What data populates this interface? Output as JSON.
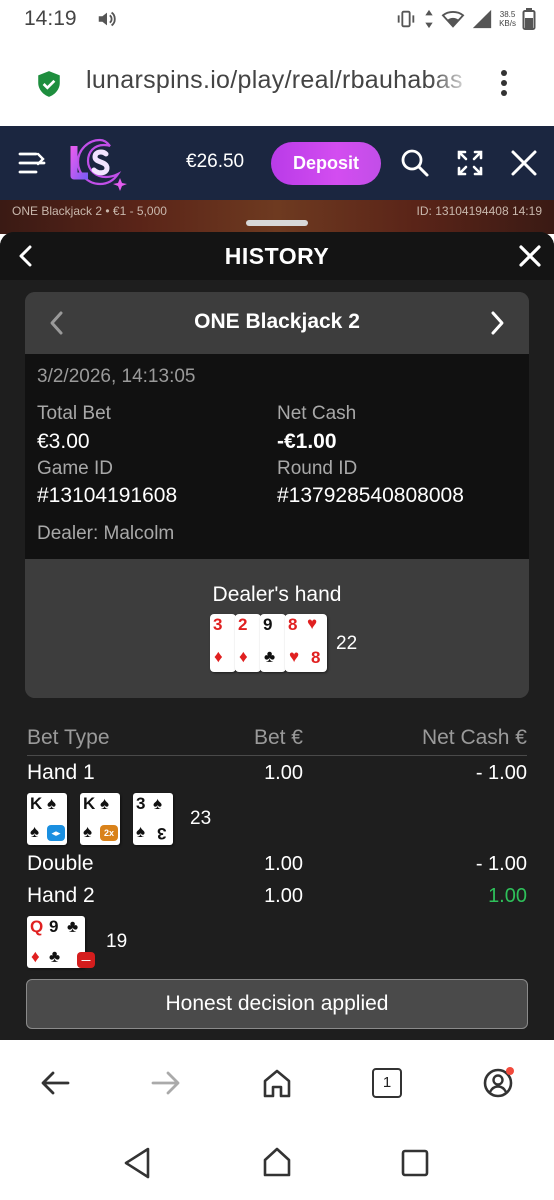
{
  "status_bar": {
    "time": "14:19",
    "speed_value": "38.5",
    "speed_unit": "KB/s"
  },
  "browser": {
    "url": "lunarspins.io/play/real/rbauhabas",
    "tabs_count": "1"
  },
  "site_header": {
    "balance": "€26.50",
    "deposit_label": "Deposit"
  },
  "game_strip": {
    "left_text": "ONE Blackjack 2 • €1 - 5,000",
    "right_text": "ID: 13104194408 14:19"
  },
  "history": {
    "title": "HISTORY",
    "game_title": "ONE Blackjack 2",
    "datetime": "3/2/2026, 14:13:05",
    "total_bet_label": "Total Bet",
    "total_bet_value": "€3.00",
    "net_cash_label": "Net Cash",
    "net_cash_value": "-€1.00",
    "game_id_label": "Game ID",
    "game_id_value": "#13104191608",
    "round_id_label": "Round ID",
    "round_id_value": "#137928540808008",
    "dealer": "Dealer: Malcolm",
    "dealer_hand_label": "Dealer's hand",
    "dealer_score": "22",
    "dealer_cards": [
      {
        "rank": "3",
        "suit": "♦",
        "color": "red"
      },
      {
        "rank": "2",
        "suit": "♦",
        "color": "red"
      },
      {
        "rank": "9",
        "suit": "♣",
        "color": "black"
      },
      {
        "rank": "8",
        "suit": "♥",
        "color": "red"
      },
      {
        "rank": "",
        "suit": "♥",
        "color": "red"
      },
      {
        "rank": "8",
        "suit": "",
        "color": "red"
      }
    ],
    "table": {
      "col_bet_type": "Bet Type",
      "col_bet": "Bet €",
      "col_net_cash": "Net Cash €",
      "rows": [
        {
          "label": "Hand 1",
          "bet": "1.00",
          "net": "- 1.00"
        },
        {
          "label": "Double",
          "bet": "1.00",
          "net": "- 1.00"
        },
        {
          "label": "Hand 2",
          "bet": "1.00",
          "net": "1.00"
        }
      ]
    },
    "hand1": {
      "score": "23",
      "cards": [
        {
          "rank": "K",
          "suit": "♠",
          "badge": "split",
          "badge_color": "#1a8fe0"
        },
        {
          "rank": "K",
          "suit": "♠",
          "badge": "2x",
          "badge_color": "#d9821a"
        },
        {
          "rank": "3",
          "suit": "♠",
          "badge": "",
          "badge_color": ""
        }
      ]
    },
    "hand2": {
      "score": "19",
      "cards": [
        {
          "rank": "Q",
          "suit": "♦",
          "color": "red"
        },
        {
          "rank": "9",
          "suit": "♣",
          "color": "black",
          "badge": "stand",
          "badge_color": "#d41d1d"
        }
      ]
    },
    "honest_decision_label": "Honest decision applied"
  },
  "colors": {
    "header_bg": "#1b2640",
    "deposit_accent": "#c84aee",
    "panel_bg": "#1e1e1e",
    "win_green": "#2ec05a"
  },
  "icons": [
    "volume-icon",
    "vibrate-icon",
    "data-arrows-icon",
    "wifi-icon",
    "signal-icon",
    "battery-icon",
    "shield-lock-icon",
    "more-vert-icon",
    "menu-icon",
    "search-icon",
    "fullscreen-icon",
    "close-icon",
    "back-arrow-icon",
    "forward-arrow-icon",
    "home-icon",
    "account-icon"
  ]
}
